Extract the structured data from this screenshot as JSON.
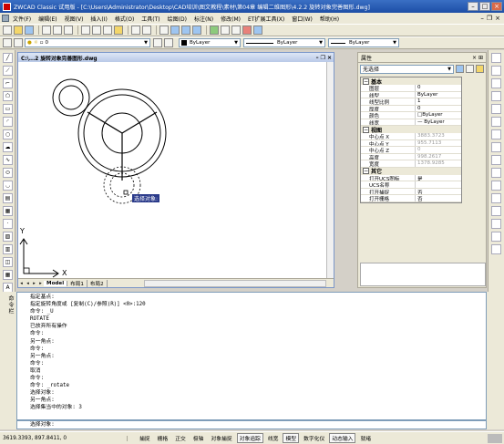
{
  "window": {
    "title": "ZWCAD Classic 试用版 - [C:\\Users\\Administrator\\Desktop\\CAD培训\\图文教程\\素材\\第04章 编辑二维图形\\4.2.2 旋转对象完善图形.dwg]"
  },
  "menu": {
    "items": [
      "文件(F)",
      "编辑(E)",
      "视图(V)",
      "插入(I)",
      "格式(O)",
      "工具(T)",
      "绘图(D)",
      "标注(N)",
      "修改(M)",
      "ET扩展工具(X)",
      "窗口(W)",
      "帮助(H)"
    ]
  },
  "toolbar": {
    "layer_value": "0",
    "color_value": "ByLayer",
    "linetype_value": "ByLayer",
    "lineweight_value": "ByLayer"
  },
  "drawing_window": {
    "title": "C:\\...2 旋转对象完善图形.dwg",
    "tabs": [
      "Model",
      "布局1",
      "布局2"
    ],
    "prompt_tooltip": "选择对象:",
    "ucs_labels": {
      "x": "X",
      "y": "Y"
    }
  },
  "properties": {
    "title": "属性",
    "selection": "无选择",
    "sections": [
      {
        "name": "基本",
        "rows": [
          {
            "name": "图层",
            "value": "0"
          },
          {
            "name": "线型",
            "value": "ByLayer"
          },
          {
            "name": "线型比例",
            "value": "1"
          },
          {
            "name": "厚度",
            "value": "0"
          },
          {
            "name": "颜色",
            "value": "ByLayer"
          },
          {
            "name": "线宽",
            "value": "— ByLayer"
          }
        ]
      },
      {
        "name": "视图",
        "rows": [
          {
            "name": "中心点 X",
            "value": "3883.3723",
            "dim": true
          },
          {
            "name": "中心点 Y",
            "value": "955.7113",
            "dim": true
          },
          {
            "name": "中心点 Z",
            "value": "0",
            "dim": true
          },
          {
            "name": "高度",
            "value": "998.2617",
            "dim": true
          },
          {
            "name": "宽度",
            "value": "1378.9285",
            "dim": true
          }
        ]
      },
      {
        "name": "其它",
        "rows": [
          {
            "name": "打开UCS图标",
            "value": "是"
          },
          {
            "name": "UCS名称",
            "value": ""
          },
          {
            "name": "打开捕捉",
            "value": "否"
          },
          {
            "name": "打开栅格",
            "value": "否"
          }
        ]
      }
    ]
  },
  "command": {
    "label": "命令栏",
    "history": [
      "指定基点:",
      "指定旋转角度或 [复制(C)/参照(R)] <0>:120",
      "命令: _U",
      "ROTATE",
      "已放弃所有操作",
      "命令:",
      "另一角点:",
      "命令:",
      "另一角点:",
      "命令:",
      "取消",
      "命令:",
      "命令: _rotate",
      "选择对象:",
      "另一角点:",
      "选择集当中的对象: 3"
    ],
    "input": "选择对象:"
  },
  "status": {
    "coords": "3619.3393,  897.8411,  0",
    "buttons": [
      {
        "label": "捕捉",
        "on": false
      },
      {
        "label": "栅格",
        "on": false
      },
      {
        "label": "正交",
        "on": false
      },
      {
        "label": "极轴",
        "on": false
      },
      {
        "label": "对象捕捉",
        "on": false
      },
      {
        "label": "对象追踪",
        "on": true
      },
      {
        "label": "线宽",
        "on": false
      },
      {
        "label": "模型",
        "on": true
      },
      {
        "label": "数字化仪",
        "on": false
      },
      {
        "label": "动态输入",
        "on": true
      },
      {
        "label": "就绪",
        "on": false
      }
    ]
  }
}
